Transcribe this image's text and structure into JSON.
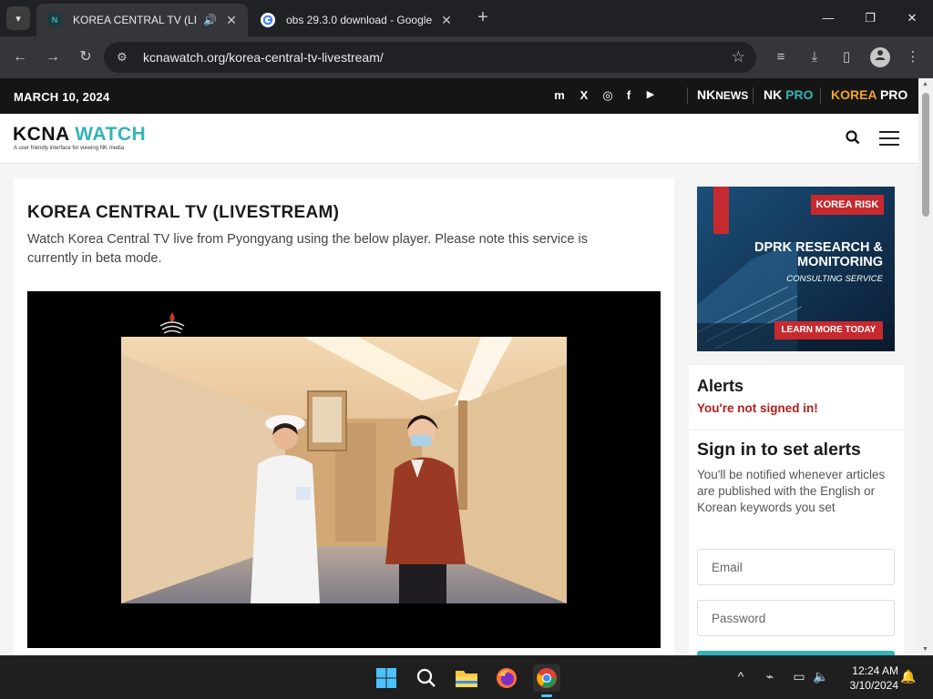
{
  "browser": {
    "tabs": [
      {
        "title": "KOREA CENTRAL TV (LIVEST",
        "active": true,
        "favicon": "kcna-favicon",
        "audio_icon": "🔊",
        "close": "✕"
      },
      {
        "title": "obs 29.3.0 download - Google",
        "active": false,
        "favicon": "google-favicon",
        "close": "✕"
      }
    ],
    "new_tab": "+",
    "window_controls": {
      "minimize": "—",
      "restore": "❐",
      "close": "✕"
    },
    "nav": {
      "back": "←",
      "forward": "→",
      "reload": "↻"
    },
    "url": "kcnawatch.org/korea-central-tv-livestream/",
    "site_info_icon": "⚙",
    "bookmark_icon": "☆",
    "toolbar_icons": {
      "media": "≡",
      "download": "⤓",
      "sidepanel": "▯",
      "profile": "●",
      "menu": "⋮"
    }
  },
  "site": {
    "date": "MARCH 10, 2024",
    "social": {
      "mastodon": "m",
      "x": "X",
      "instagram": "◎",
      "facebook": "f",
      "youtube": "▶"
    },
    "brands": {
      "nknews_a": "NK",
      "nknews_b": "NEWS",
      "nkpro_a": "NK ",
      "nkpro_b": "PRO",
      "koreapro_a": "KOREA ",
      "koreapro_b": "PRO"
    },
    "logo": {
      "part1": "KCNA ",
      "part2": "WATCH",
      "tagline": "A user friendly interface for viewing NK media"
    },
    "search_icon": "⌕"
  },
  "article": {
    "title": "KOREA CENTRAL TV (LIVESTREAM)",
    "description": "Watch Korea Central TV live from Pyongyang using the below player. Please note this service is currently in beta mode."
  },
  "ad": {
    "brand": "KOREA RISK",
    "headline_1": "DPRK RESEARCH &",
    "headline_2": "MONITORING",
    "subline": "CONSULTING SERVICE",
    "cta": "LEARN MORE TODAY"
  },
  "alerts": {
    "title": "Alerts",
    "status": "You're not signed in!"
  },
  "signin": {
    "title": "Sign in to set alerts",
    "body": "You'll be notified whenever articles are published with the English or Korean keywords you set",
    "email_placeholder": "Email",
    "password_placeholder": "Password"
  },
  "taskbar": {
    "time": "12:24 AM",
    "date": "3/10/2024",
    "tray": {
      "chevron": "^",
      "network": "⌁",
      "battery": "▭",
      "volume": "🔈",
      "notifications": "🔔"
    }
  },
  "colors": {
    "accent": "#35b3b6",
    "alert_red": "#b31d1d",
    "koreapro_orange": "#f5a623",
    "nkpro_teal": "#35b3b6"
  }
}
